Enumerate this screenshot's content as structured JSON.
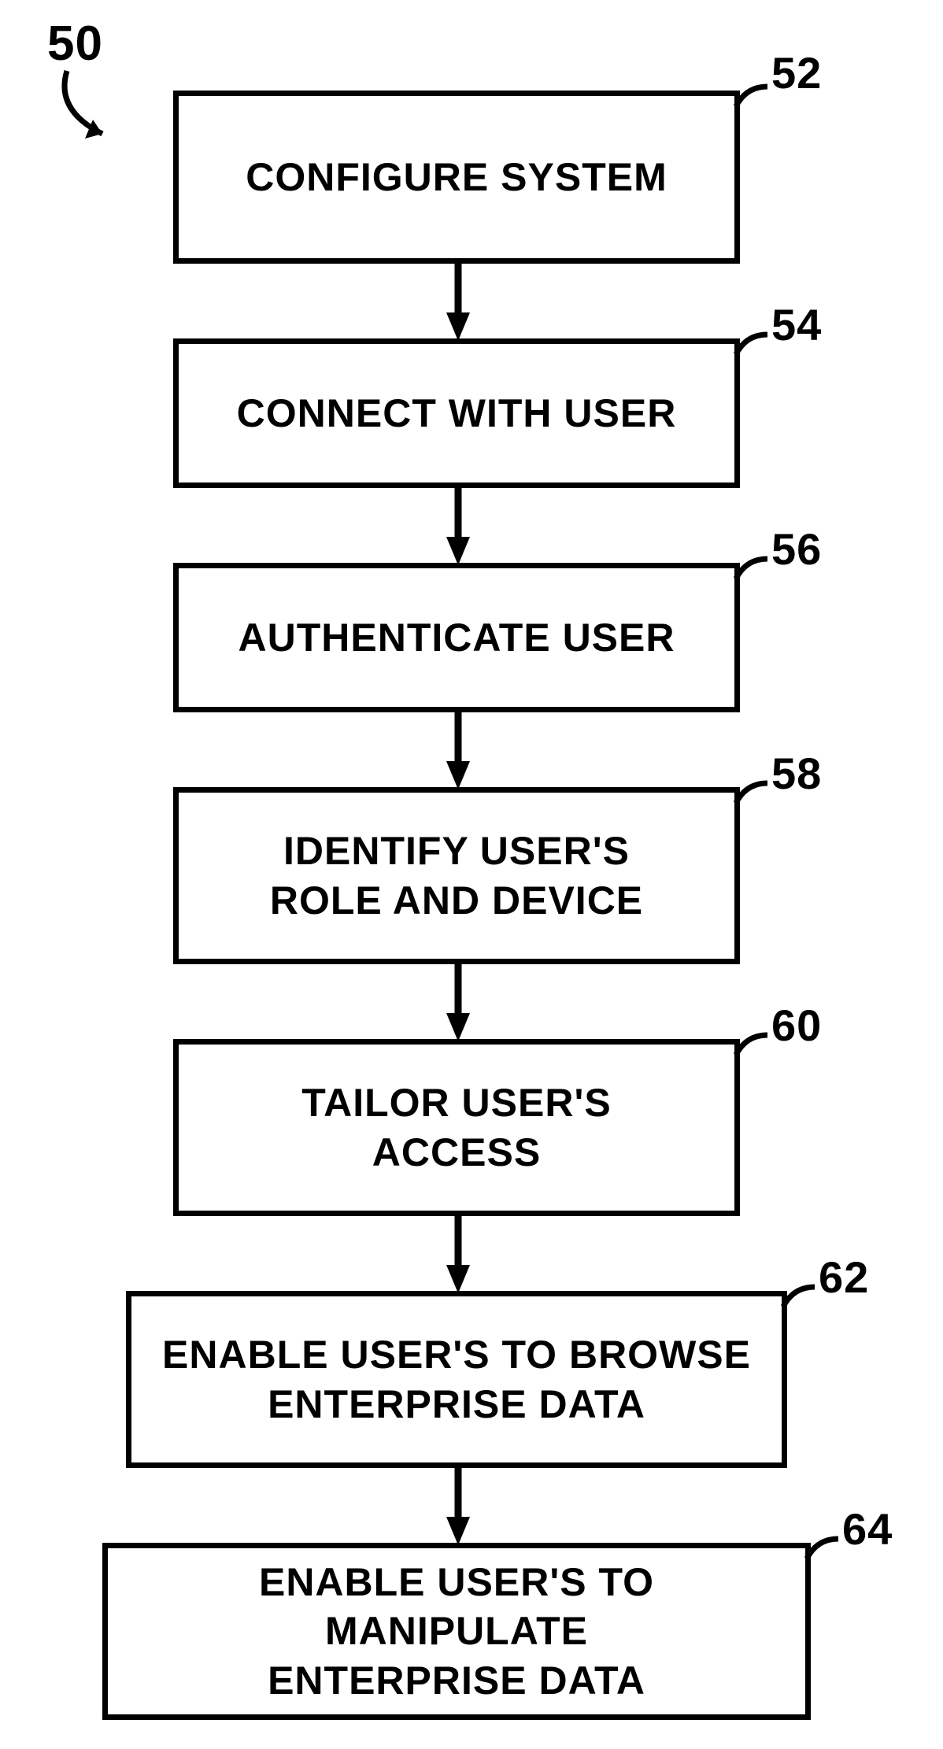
{
  "diagram": {
    "flowchart_label": "50",
    "steps": [
      {
        "ref": "52",
        "text": "CONFIGURE SYSTEM"
      },
      {
        "ref": "54",
        "text": "CONNECT WITH USER"
      },
      {
        "ref": "56",
        "text": "AUTHENTICATE USER"
      },
      {
        "ref": "58",
        "text": "IDENTIFY USER'S\nROLE AND DEVICE"
      },
      {
        "ref": "60",
        "text": "TAILOR USER'S\nACCESS"
      },
      {
        "ref": "62",
        "text": "ENABLE USER'S TO BROWSE\nENTERPRISE DATA"
      },
      {
        "ref": "64",
        "text": "ENABLE USER'S TO MANIPULATE\nENTERPRISE DATA"
      }
    ]
  }
}
